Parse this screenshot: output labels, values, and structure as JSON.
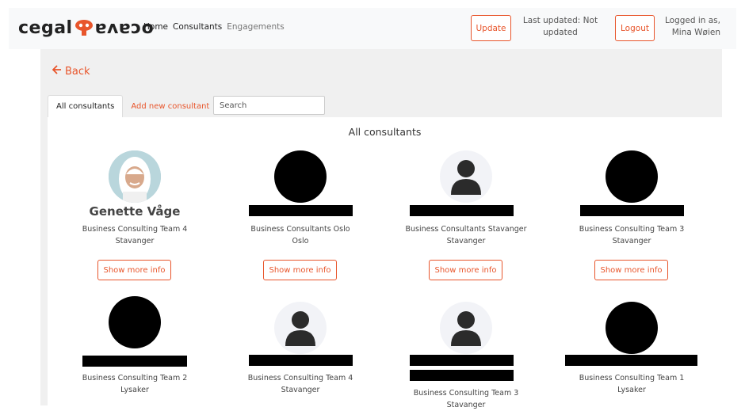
{
  "brand": {
    "left": "cegal",
    "right": "ɐʌɐɔo",
    "accent": "#e8552b"
  },
  "nav": {
    "home": "Home",
    "consultants": "Consultants",
    "engagements": "Engagements"
  },
  "header": {
    "update_label": "Update",
    "last_updated_line1": "Last updated: Not",
    "last_updated_line2": "updated",
    "logout_label": "Logout",
    "logged_in_line1": "Logged in as,",
    "logged_in_line2": "Mina Wøien"
  },
  "back_label": "Back",
  "tabs": {
    "all": "All consultants",
    "add": "Add new consultant"
  },
  "search": {
    "placeholder": "Search"
  },
  "section_title": "All consultants",
  "consultants": [
    {
      "name": "Genette Våge",
      "team": "Business Consulting Team 4",
      "location": "Stavanger",
      "avatar": "photo",
      "button": "Show more info"
    },
    {
      "name": "",
      "team": "Business Consultants Oslo",
      "location": "Oslo",
      "avatar": "redacted",
      "button": "Show more info"
    },
    {
      "name": "",
      "team": "Business Consultants Stavanger",
      "location": "Stavanger",
      "avatar": "default-person-icon",
      "button": "Show more info"
    },
    {
      "name": "",
      "team": "Business Consulting Team 3",
      "location": "Stavanger",
      "avatar": "redacted",
      "button": "Show more info"
    },
    {
      "name": "",
      "team": "Business Consulting Team 2",
      "location": "Lysaker",
      "avatar": "redacted"
    },
    {
      "name": "",
      "team": "Business Consulting Team 4",
      "location": "Stavanger",
      "avatar": "default-person-icon"
    },
    {
      "name": "",
      "team": "Business Consulting Team 3",
      "location": "Stavanger",
      "avatar": "default-person-icon"
    },
    {
      "name": "",
      "team": "Business Consulting Team 1",
      "location": "Lysaker",
      "avatar": "redacted"
    }
  ]
}
